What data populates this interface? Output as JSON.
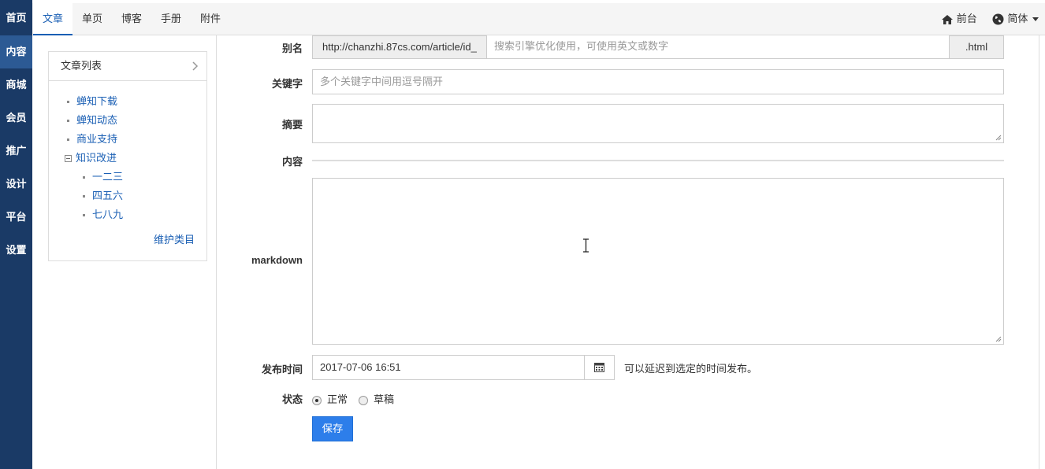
{
  "left_nav": {
    "items": [
      {
        "label": "首页"
      },
      {
        "label": "内容"
      },
      {
        "label": "商城"
      },
      {
        "label": "会员"
      },
      {
        "label": "推广"
      },
      {
        "label": "设计"
      },
      {
        "label": "平台"
      },
      {
        "label": "设置"
      }
    ],
    "active_index": 1
  },
  "top_tabs": {
    "items": [
      {
        "label": "文章"
      },
      {
        "label": "单页"
      },
      {
        "label": "博客"
      },
      {
        "label": "手册"
      },
      {
        "label": "附件"
      }
    ],
    "active_index": 0
  },
  "top_right": {
    "frontend_label": "前台",
    "language_label": "简体"
  },
  "sidebar": {
    "title": "文章列表",
    "categories": [
      {
        "label": "蝉知下载"
      },
      {
        "label": "蝉知动态"
      },
      {
        "label": "商业支持"
      },
      {
        "label": "知识改进"
      },
      {
        "label": "一二三"
      },
      {
        "label": "四五六"
      },
      {
        "label": "七八九"
      }
    ],
    "maintain_link": "维护类目"
  },
  "form": {
    "alias": {
      "label": "别名",
      "prefix": "http://chanzhi.87cs.com/article/id_",
      "placeholder": "搜索引擎优化使用，可使用英文或数字",
      "suffix": ".html"
    },
    "keywords": {
      "label": "关键字",
      "placeholder": "多个关键字中间用逗号隔开"
    },
    "summary": {
      "label": "摘要"
    },
    "content": {
      "label": "内容"
    },
    "markdown": {
      "label": "markdown"
    },
    "publish_time": {
      "label": "发布时间",
      "value": "2017-07-06 16:51",
      "hint": "可以延迟到选定的时间发布。"
    },
    "status": {
      "label": "状态",
      "options": [
        {
          "label": "正常",
          "checked": true
        },
        {
          "label": "草稿",
          "checked": false
        }
      ]
    },
    "save_label": "保存"
  },
  "colors": {
    "nav_bg": "#1a3a66",
    "nav_active": "#2c5a94",
    "link": "#1a5fb4",
    "primary_button": "#2d7eea"
  }
}
